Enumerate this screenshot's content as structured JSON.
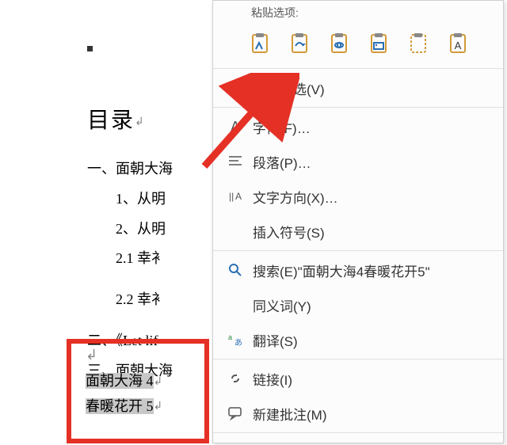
{
  "document": {
    "title": "目录",
    "lines": {
      "l1": "一、面朝大海",
      "l2": "1、从明",
      "l3": "2、从明",
      "l4": "2.1  幸衤",
      "l5": "2.2  幸衤",
      "l6": "二、《Let lif",
      "l7": "三、面朝大海"
    },
    "selected_lines": {
      "s1": "面朝大海 4",
      "s2": "春暖花开 5"
    },
    "para_mark": "↲"
  },
  "menu": {
    "paste_header": "粘贴选项:",
    "items": {
      "rechoose": "汉字重选(V)",
      "font": "字体(F)…",
      "paragraph": "段落(P)…",
      "textdir": "文字方向(X)…",
      "symbol": "插入符号(S)",
      "search": "搜索(E)\"面朝大海4春暖花开5\"",
      "synonym": "同义词(Y)",
      "translate": "翻译(S)",
      "link": "链接(I)",
      "comment": "新建批注(M)"
    }
  },
  "colors": {
    "highlight_red": "#e53025"
  }
}
